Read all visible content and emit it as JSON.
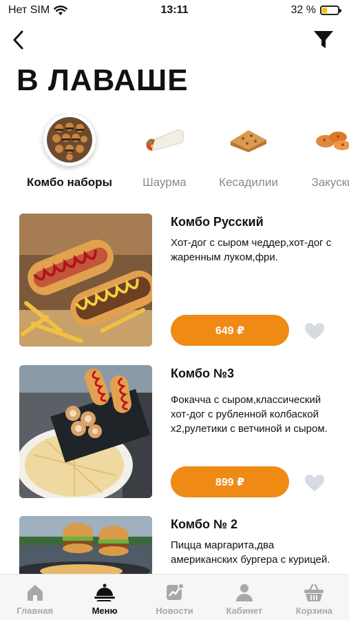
{
  "status_bar": {
    "carrier": "Нет SIM",
    "time": "13:11",
    "battery": "32 %",
    "battery_level": 0.32
  },
  "page_title": "В ЛАВАШЕ",
  "categories": [
    {
      "label": "Комбо наборы",
      "icon": "combo-sets-image",
      "active": true
    },
    {
      "label": "Шаурма",
      "icon": "shawarma-image",
      "active": false
    },
    {
      "label": "Кесадилии",
      "icon": "quesadilla-image",
      "active": false
    },
    {
      "label": "Закуски",
      "icon": "snacks-image",
      "active": false
    }
  ],
  "products": [
    {
      "name": "Комбо Русский",
      "description": "Хот-дог с сыром чеддер,хот-дог с жаренным луком,фри.",
      "price": "649 ₽"
    },
    {
      "name": "Комбо №3",
      "description": "Фокачча с сыром,классический хот-дог с рубленной колбаской х2,рулетики с ветчиной и сыром.",
      "price": "899 ₽"
    },
    {
      "name": "Комбо № 2",
      "description": "Пицца маргарита,два американских бургера с курицей.",
      "price": ""
    }
  ],
  "tab_bar": [
    {
      "label": "Главная",
      "icon": "home-icon",
      "active": false
    },
    {
      "label": "Меню",
      "icon": "menu-cloche-icon",
      "active": true
    },
    {
      "label": "Новости",
      "icon": "news-icon",
      "active": false
    },
    {
      "label": "Кабинет",
      "icon": "profile-icon",
      "active": false
    },
    {
      "label": "Корзина",
      "icon": "basket-icon",
      "active": false
    }
  ],
  "colors": {
    "accent": "#ef8a14",
    "inactive": "#a8a8a8",
    "heart": "#d6dbe3"
  }
}
